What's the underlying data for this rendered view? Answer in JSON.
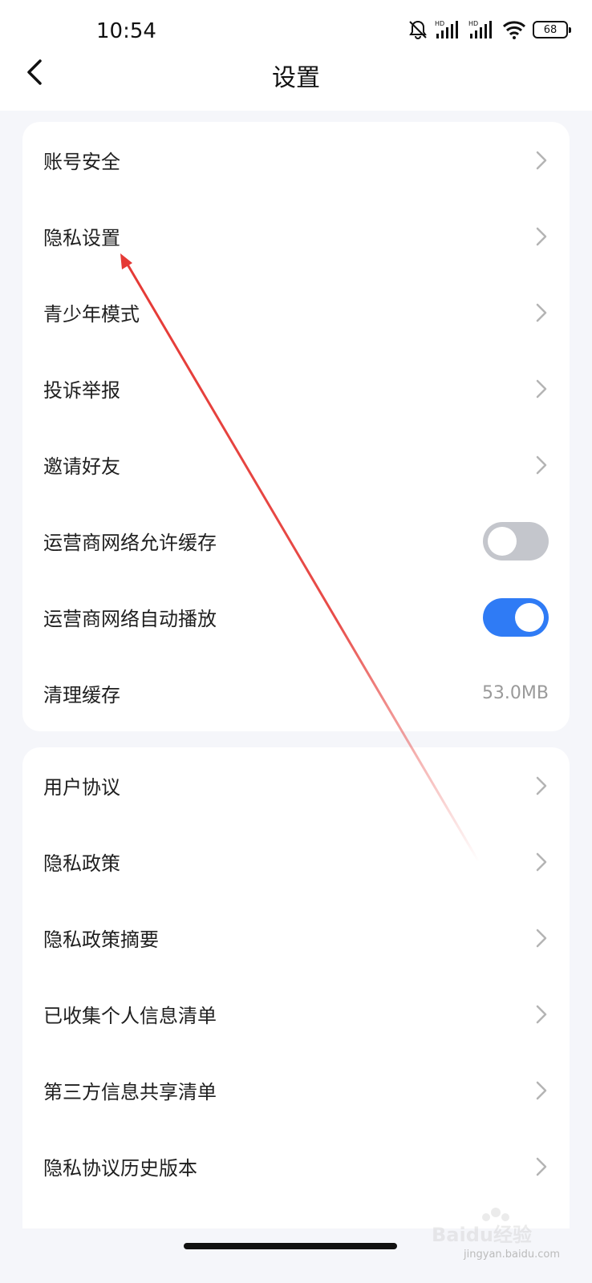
{
  "status_bar": {
    "time": "10:54",
    "battery": "68",
    "icons": [
      "bell-off-icon",
      "hd-signal-icon",
      "hd-signal-icon",
      "wifi-icon",
      "battery-icon"
    ]
  },
  "header": {
    "title": "设置",
    "back_icon": "back-arrow-icon"
  },
  "group1": {
    "items": [
      {
        "label": "账号安全",
        "type": "nav"
      },
      {
        "label": "隐私设置",
        "type": "nav"
      },
      {
        "label": "青少年模式",
        "type": "nav"
      },
      {
        "label": "投诉举报",
        "type": "nav"
      },
      {
        "label": "邀请好友",
        "type": "nav"
      },
      {
        "label": "运营商网络允许缓存",
        "type": "toggle",
        "state": "off"
      },
      {
        "label": "运营商网络自动播放",
        "type": "toggle",
        "state": "on"
      },
      {
        "label": "清理缓存",
        "type": "value",
        "value": "53.0MB"
      }
    ]
  },
  "group2": {
    "items": [
      {
        "label": "用户协议",
        "type": "nav"
      },
      {
        "label": "隐私政策",
        "type": "nav"
      },
      {
        "label": "隐私政策摘要",
        "type": "nav"
      },
      {
        "label": "已收集个人信息清单",
        "type": "nav"
      },
      {
        "label": "第三方信息共享清单",
        "type": "nav"
      },
      {
        "label": "隐私协议历史版本",
        "type": "nav"
      }
    ]
  },
  "colors": {
    "toggle_on": "#2f7bf5",
    "toggle_off": "#c4c6cc",
    "annotation_arrow": "#e53935"
  },
  "watermark": {
    "logo": "Baidu经验",
    "url": "jingyan.baidu.com"
  }
}
